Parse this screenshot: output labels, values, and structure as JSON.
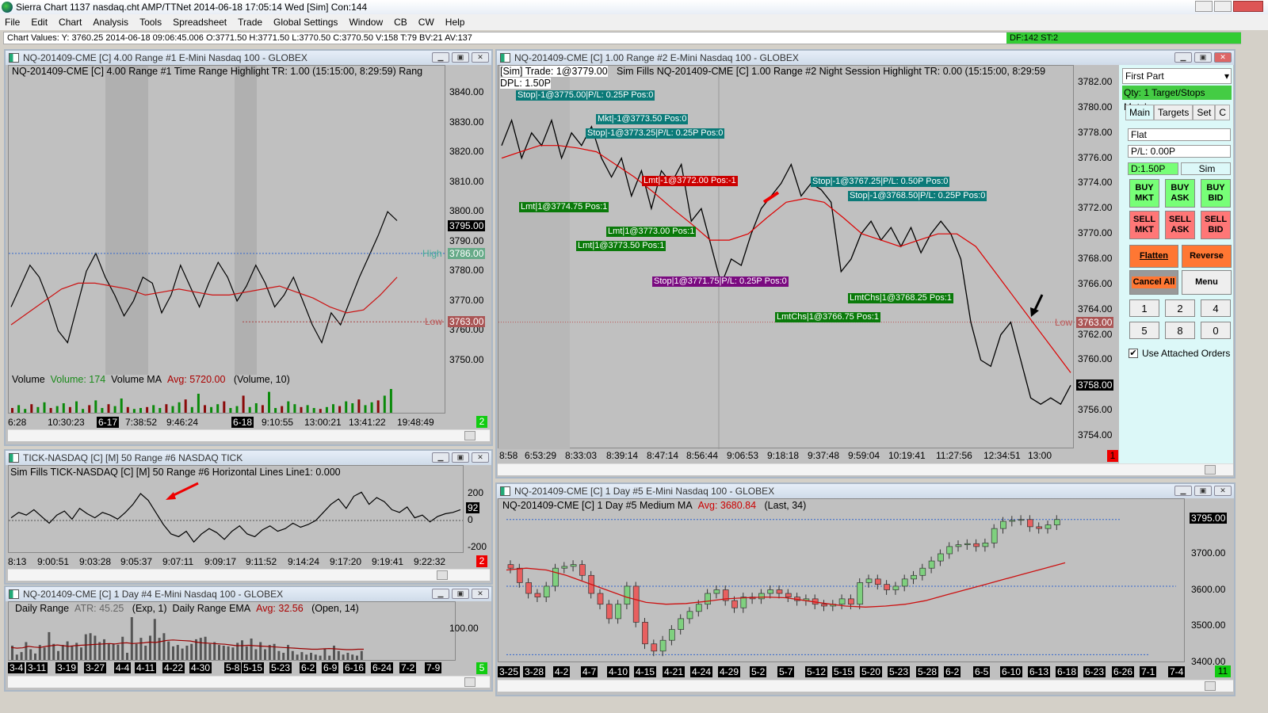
{
  "app": {
    "title": "Sierra Chart 1137 nasdaq.cht  AMP/TTNet 2014-06-18  17:05:14 Wed [Sim]  Con:144",
    "menu": [
      "File",
      "Edit",
      "Chart",
      "Analysis",
      "Tools",
      "Spreadsheet",
      "Trade",
      "Global Settings",
      "Window",
      "CB",
      "CW",
      "Help"
    ],
    "chart_values": "Chart Values: Y: 3760.25  2014-06-18  09:06:45.006  O:3771.50  H:3771.50  L:3770.50  C:3770.50  V:158  T:79  BV:21  AV:137",
    "status_right": "DF:142  ST:2"
  },
  "chart1": {
    "title": "NQ-201409-CME [C]  4.00 Range  #1  E-Mini Nasdaq 100 - GLOBEX",
    "header": "NQ-201409-CME [C]  4.00 Range  #1  Time Range Highlight  TR: 1.00   (15:15:00, 8:29:59)  Rang",
    "yticks": [
      "3840.00",
      "3830.00",
      "3820.00",
      "3810.00",
      "3800.00",
      "3790.00",
      "3780.00",
      "3770.00",
      "3760.00",
      "3750.00"
    ],
    "last": "3795.00",
    "high_label": "High",
    "high_val": "3786.00",
    "low_label": "Low",
    "low_val": "3763.00",
    "vol_label": "Volume",
    "vol_value": "Volume: 174",
    "vol_ma": "Volume MA",
    "vol_avg": "Avg: 5720.00",
    "vol_params": "(Volume, 10)",
    "xticks": [
      "6:28",
      "10:30:23",
      "6-17",
      "7:38:52",
      "9:46:24",
      "6-18",
      "9:10:55",
      "13:00:21",
      "13:41:22",
      "19:48:49"
    ],
    "badge": "2",
    "price": [
      3768,
      3775,
      3782,
      3778,
      3770,
      3760,
      3756,
      3768,
      3780,
      3786,
      3778,
      3772,
      3765,
      3770,
      3778,
      3776,
      3766,
      3772,
      3782,
      3775,
      3768,
      3776,
      3783,
      3778,
      3770,
      3775,
      3782,
      3776,
      3768,
      3772,
      3778,
      3770,
      3762,
      3756,
      3766,
      3762,
      3770,
      3778,
      3785,
      3792,
      3800,
      3797
    ],
    "ma": [
      3762,
      3766,
      3770,
      3774,
      3776,
      3776,
      3775,
      3774,
      3772,
      3773,
      3774,
      3773,
      3772,
      3772,
      3773,
      3774,
      3775,
      3773,
      3771,
      3768,
      3766,
      3767,
      3772,
      3778
    ],
    "volume": [
      5,
      8,
      4,
      9,
      6,
      11,
      5,
      7,
      10,
      6,
      12,
      4,
      8,
      13,
      5,
      9,
      7,
      15,
      6,
      4,
      5,
      6,
      8,
      5,
      9,
      7,
      11,
      14,
      6,
      20,
      8,
      6,
      9,
      12,
      5,
      7,
      18,
      6,
      10,
      8,
      22,
      5,
      7,
      12,
      9,
      6,
      8,
      5,
      4,
      6,
      9,
      7,
      12,
      10,
      14,
      8,
      11,
      13,
      18,
      25
    ]
  },
  "tick": {
    "title": "TICK-NASDAQ [C] [M]  50 Range  #6  NASDAQ TICK",
    "header": "Sim Fills  TICK-NASDAQ [C] [M]  50 Range  #6  Horizontal Lines  Line1: 0.000",
    "yticks": [
      "200",
      "0",
      "-200"
    ],
    "last": "92",
    "xticks": [
      "8:13",
      "9:00:51",
      "9:03:28",
      "9:05:37",
      "9:07:11",
      "9:09:17",
      "9:11:52",
      "9:14:24",
      "9:17:20",
      "9:19:41",
      "9:22:32"
    ],
    "badge": "2",
    "values": [
      20,
      60,
      40,
      80,
      30,
      -20,
      40,
      70,
      10,
      90,
      50,
      20,
      60,
      40,
      10,
      60,
      120,
      200,
      150,
      60,
      -30,
      -100,
      -120,
      -80,
      -160,
      -100,
      -60,
      -90,
      -140,
      -80,
      -40,
      -100,
      -120,
      -70,
      -40,
      -80,
      -60,
      -20,
      -50,
      -30,
      0,
      60,
      120,
      160,
      90,
      180,
      210,
      120,
      170,
      140,
      80,
      60,
      100,
      20,
      40,
      -10,
      30,
      50,
      60,
      80
    ]
  },
  "range": {
    "title": "NQ-201409-CME [C]  1 Day  #4  E-Mini Nasdaq 100 - GLOBEX",
    "label": "Daily Range",
    "atr": "ATR: 45.25",
    "p1": "(Exp, 1)",
    "ema_label": "Daily Range EMA",
    "avg": "Avg: 32.56",
    "p2": "(Open, 14)",
    "ytick": "100.00",
    "badge": "5",
    "xticks": [
      "3-4",
      "3-11",
      "3-19",
      "3-27",
      "4-4",
      "4-11",
      "4-22",
      "4-30",
      "5-8",
      "5-15",
      "5-23",
      "6-2",
      "6-9",
      "6-16",
      "6-24",
      "7-2",
      "7-9"
    ],
    "bars": [
      40,
      15,
      22,
      50,
      30,
      18,
      42,
      35,
      78,
      45,
      25,
      42,
      52,
      38,
      48,
      35,
      72,
      75,
      68,
      50,
      58,
      45,
      45,
      43,
      65,
      20,
      120,
      45,
      62,
      40,
      68,
      115,
      62,
      75,
      52,
      38,
      42,
      32,
      40,
      45,
      58,
      62,
      65,
      45,
      50,
      42,
      40,
      38,
      35,
      48,
      55,
      38,
      60,
      30,
      50,
      30,
      42,
      45,
      25,
      20,
      42,
      25,
      15,
      22,
      15,
      20,
      15,
      12,
      30,
      12,
      40,
      25,
      15,
      20,
      15,
      12,
      25
    ],
    "ema": [
      35,
      33,
      34,
      38,
      36,
      35,
      38,
      40,
      42,
      40,
      38,
      40,
      41,
      42,
      43,
      44,
      45,
      46,
      45,
      47,
      48,
      46,
      47,
      48,
      50,
      49,
      52,
      55,
      56,
      55,
      54,
      53,
      50,
      48,
      47,
      46,
      45,
      44,
      42,
      40,
      40,
      41,
      40,
      39,
      38,
      37,
      36,
      35,
      34,
      33,
      32,
      31,
      30,
      30,
      31,
      32,
      31,
      30,
      29,
      29,
      30,
      30
    ]
  },
  "main": {
    "title": "NQ-201409-CME [C]  1.00 Range  #2  E-Mini Nasdaq 100 - GLOBEX",
    "sim_trade": "[Sim]  Trade: 1@3779.00",
    "header": "Sim Fills  NQ-201409-CME [C]  1.00 Range  #2  Night Session Highlight  TR: 0.00   (15:15:00, 8:29:59",
    "dpl": "DPL: 1.50P",
    "yticks": [
      "3782.00",
      "3780.00",
      "3778.00",
      "3776.00",
      "3774.00",
      "3772.00",
      "3770.00",
      "3768.00",
      "3766.00",
      "3764.00",
      "3762.00",
      "3760.00",
      "3758.00",
      "3756.00",
      "3754.00"
    ],
    "low_label": "Low",
    "low_val": "3763.00",
    "last": "3758.00",
    "xticks": [
      "8:58",
      "6:53:29",
      "8:33:03",
      "8:39:14",
      "8:47:14",
      "8:56:44",
      "9:06:53",
      "9:18:18",
      "9:37:48",
      "9:59:04",
      "10:19:41",
      "11:27:56",
      "12:34:51",
      "13:00"
    ],
    "badge": "1",
    "orders": [
      "Stop|-1@3775.00|P/L: 0.25P Pos:0",
      "Mkt|-1@3773.50 Pos:0",
      "Stop|-1@3773.25|P/L: 0.25P Pos:0",
      "Lmt|-1@3772.00 Pos:-1",
      "Lmt|1@3774.75 Pos:1",
      "Lmt|1@3773.00 Pos:1",
      "Lmt|1@3773.50 Pos:1",
      "Stop|1@3771.75|P/L: 0.25P Pos:0",
      "Stop|-1@3767.25|P/L: 0.50P Pos:0",
      "Stop|-1@3768.50|P/L: 0.25P Pos:0",
      "LmtChs|1@3768.25 Pos:1",
      "LmtChs|1@3766.75 Pos:1"
    ],
    "price": [
      3777,
      3779,
      3776,
      3778,
      3777,
      3779,
      3776,
      3778,
      3777,
      3778.5,
      3776,
      3774.5,
      3776,
      3773,
      3775,
      3772,
      3775,
      3774,
      3775.5,
      3771,
      3772,
      3769,
      3766,
      3768,
      3767.5,
      3770,
      3772,
      3773,
      3774,
      3775.5,
      3773,
      3774,
      3773.5,
      3772.5,
      3767,
      3768,
      3770,
      3771,
      3769.5,
      3770.5,
      3769,
      3770.5,
      3768.5,
      3770,
      3771,
      3770,
      3768,
      3763,
      3760,
      3759.5,
      3762,
      3763,
      3760,
      3757,
      3756.5,
      3757,
      3756.5,
      3758
    ],
    "ma": [
      3776,
      3776.5,
      3777,
      3777,
      3776.8,
      3776.5,
      3775.5,
      3774.5,
      3773.3,
      3772,
      3770.8,
      3769.5,
      3769.5,
      3770,
      3771.3,
      3772.5,
      3772.8,
      3772.5,
      3771.3,
      3770,
      3769.5,
      3769,
      3769.5,
      3770,
      3770,
      3769,
      3767,
      3765,
      3763,
      3761,
      3759
    ]
  },
  "panel": {
    "dropdown": "First Part",
    "qty": "Qty: 1 Target/Stops Match",
    "tabs": [
      "Main",
      "Targets",
      "Set",
      "C"
    ],
    "position": "Flat",
    "pl": "P/L: 0.00P",
    "dpl": "D:1.50P",
    "mode": "Sim",
    "buy": [
      "BUY MKT",
      "BUY ASK",
      "BUY BID"
    ],
    "sell": [
      "SELL MKT",
      "SELL ASK",
      "SELL BID"
    ],
    "flatten": "Flatten",
    "reverse": "Reverse",
    "cancel_all": "Cancel All",
    "menu": "Menu",
    "qty_buttons": [
      "1",
      "2",
      "4",
      "5",
      "8",
      "0"
    ],
    "use_attached": "Use Attached Orders",
    "use_attached_checked": true
  },
  "daily": {
    "title": "NQ-201409-CME [C]  1 Day  #5  E-Mini Nasdaq 100 - GLOBEX",
    "header_main": "NQ-201409-CME [C]  1 Day   #5  Medium MA",
    "avg": "Avg: 3680.84",
    "params": "(Last, 34)",
    "yticks": [
      "3700.00",
      "3600.00",
      "3500.00",
      "3400.00"
    ],
    "last": "3795.00",
    "badge": "11",
    "xticks": [
      "3-25",
      "3-28",
      "4-2",
      "4-7",
      "4-10",
      "4-15",
      "4-21",
      "4-24",
      "4-29",
      "5-2",
      "5-7",
      "5-12",
      "5-15",
      "5-20",
      "5-23",
      "5-28",
      "6-2",
      "6-5",
      "6-10",
      "6-13",
      "6-18",
      "6-23",
      "6-26",
      "7-1",
      "7-4"
    ],
    "closes": [
      3660,
      3620,
      3590,
      3580,
      3610,
      3660,
      3665,
      3670,
      3640,
      3590,
      3560,
      3520,
      3560,
      3610,
      3510,
      3450,
      3430,
      3460,
      3490,
      3520,
      3540,
      3560,
      3590,
      3600,
      3570,
      3550,
      3580,
      3575,
      3590,
      3600,
      3590,
      3580,
      3570,
      3575,
      3560,
      3555,
      3560,
      3575,
      3560,
      3620,
      3630,
      3615,
      3600,
      3610,
      3630,
      3640,
      3660,
      3680,
      3700,
      3720,
      3725,
      3728,
      3720,
      3730,
      3770,
      3790,
      3793,
      3795,
      3775,
      3770,
      3780,
      3795
    ],
    "ma": [
      3655,
      3660,
      3655,
      3640,
      3620,
      3600,
      3580,
      3565,
      3560,
      3562,
      3568,
      3575,
      3578,
      3580,
      3578,
      3570,
      3562,
      3555,
      3552,
      3555,
      3560,
      3570,
      3585,
      3600,
      3615,
      3630,
      3645,
      3660,
      3675
    ]
  },
  "colors": {
    "up": "#7fd07f",
    "down": "#e86060",
    "ma": "#cc1010",
    "buy": "#77ff77",
    "sell": "#ff7777",
    "orange": "#ff7733"
  }
}
